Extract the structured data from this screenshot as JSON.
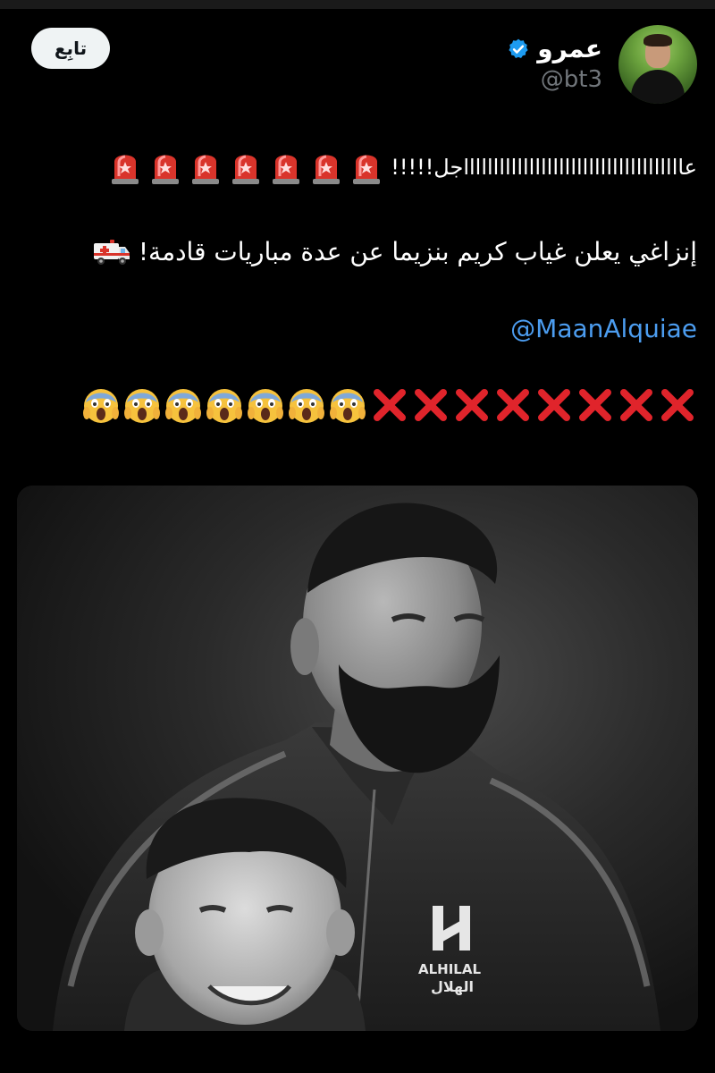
{
  "tweet": {
    "display_name": "عمرو",
    "handle": "@bt3",
    "verified_icon": "verified-badge-icon",
    "follow_label": "تابِع",
    "line1_text": "عاااااااااااااااااااااااااااااااااااااجل!!!!!",
    "line1_emoji": "police-light-icon",
    "line1_emoji_count": 7,
    "line2_text": "إنزاغي يعلن غياب كريم بنزيما عن عدة مباريات قادمة!",
    "line2_emoji": "ambulance-icon",
    "mention": "@MaanAlquiae",
    "line4_x_count": 8,
    "line4_scream_count": 7,
    "line4_emojis": [
      "cross-mark-icon",
      "face-screaming-icon"
    ]
  },
  "photo": {
    "crest_text_en": "ALHILAL",
    "crest_text_ar": "الهلال",
    "crest_monogram": "H"
  },
  "colors": {
    "background": "#000000",
    "text": "#ffffff",
    "secondary": "#71767b",
    "link": "#4c9df0",
    "verified": "#1d9bf0",
    "follow_bg": "#eff3f4",
    "siren_red": "#d9342b",
    "x_red": "#e0242b",
    "scream_yellow": "#f6c23d"
  }
}
